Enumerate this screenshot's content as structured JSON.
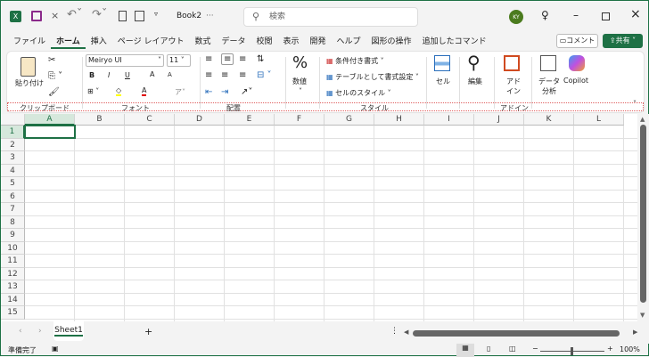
{
  "title": {
    "filename": "Book2",
    "suffix": "···",
    "search_placeholder": "検索",
    "avatar": "KY"
  },
  "tabs": [
    "ファイル",
    "ホーム",
    "挿入",
    "ページ レイアウト",
    "数式",
    "データ",
    "校閲",
    "表示",
    "開発",
    "ヘルプ",
    "図形の操作",
    "追加したコマンド"
  ],
  "active_tab": "ホーム",
  "comment_label": "コメント",
  "share_label": "共有",
  "ribbon": {
    "paste": "貼り付け",
    "font_name": "Meiryo UI",
    "font_size": "11",
    "number": "数値",
    "cond_format": "条件付き書式",
    "table_format": "テーブルとして書式設定",
    "cell_style": "セルのスタイル",
    "cells": "セル",
    "edit": "編集",
    "addin_line1": "アド",
    "addin_line2": "イン",
    "data_line1": "データ",
    "data_line2": "分析",
    "copilot": "Copilot",
    "groups": [
      "クリップボード",
      "フォント",
      "配置",
      "スタイル",
      "アドイン"
    ],
    "bold": "B",
    "italic": "I",
    "underline": "U",
    "grow": "A",
    "shrink": "A",
    "fontcolor": "A"
  },
  "columns": [
    "A",
    "B",
    "C",
    "D",
    "E",
    "F",
    "G",
    "H",
    "I",
    "J",
    "K",
    "L"
  ],
  "rows": [
    "1",
    "2",
    "3",
    "4",
    "5",
    "6",
    "7",
    "8",
    "9",
    "10",
    "11",
    "12",
    "13",
    "14",
    "15"
  ],
  "selected_cell": "A1",
  "sheets": [
    "Sheet1"
  ],
  "add_sheet": "+",
  "status": {
    "ready": "準備完了",
    "zoom": "100%",
    "zoom_minus": "−",
    "zoom_plus": "+"
  },
  "colors": {
    "accent": "#1e7145",
    "font_color": "#e00000",
    "highlight": "#ffff00"
  }
}
